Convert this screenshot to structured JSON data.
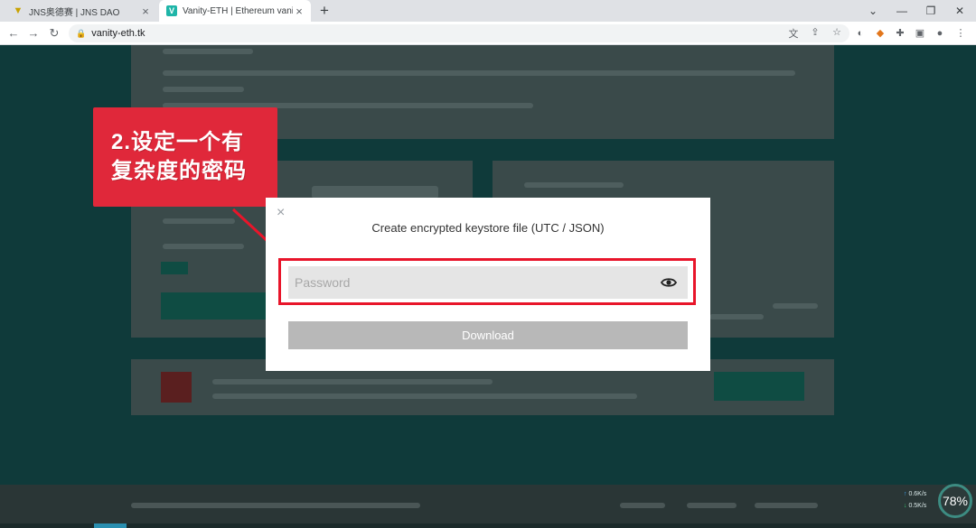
{
  "browser": {
    "tabs": [
      {
        "title": "JNS奥德赛 | JNS DAO",
        "icon": "jns-fox-icon"
      },
      {
        "title": "Vanity-ETH | Ethereum vanity a",
        "icon": "vanity-eth-icon",
        "favicon_letter": "V"
      }
    ],
    "new_tab_glyph": "+",
    "url": "vanity-eth.tk"
  },
  "callout": {
    "line1": "2.设定一个有",
    "line2": "复杂度的密码",
    "color": "#e0283a"
  },
  "modal": {
    "close_glyph": "×",
    "title": "Create encrypted keystore file (UTC / JSON)",
    "password_placeholder": "Password",
    "download_label": "Download",
    "highlight_color": "#e8152a"
  },
  "network_widget": {
    "upload": "0.6K/s",
    "download": "0.5K/s",
    "percent": "78%"
  }
}
